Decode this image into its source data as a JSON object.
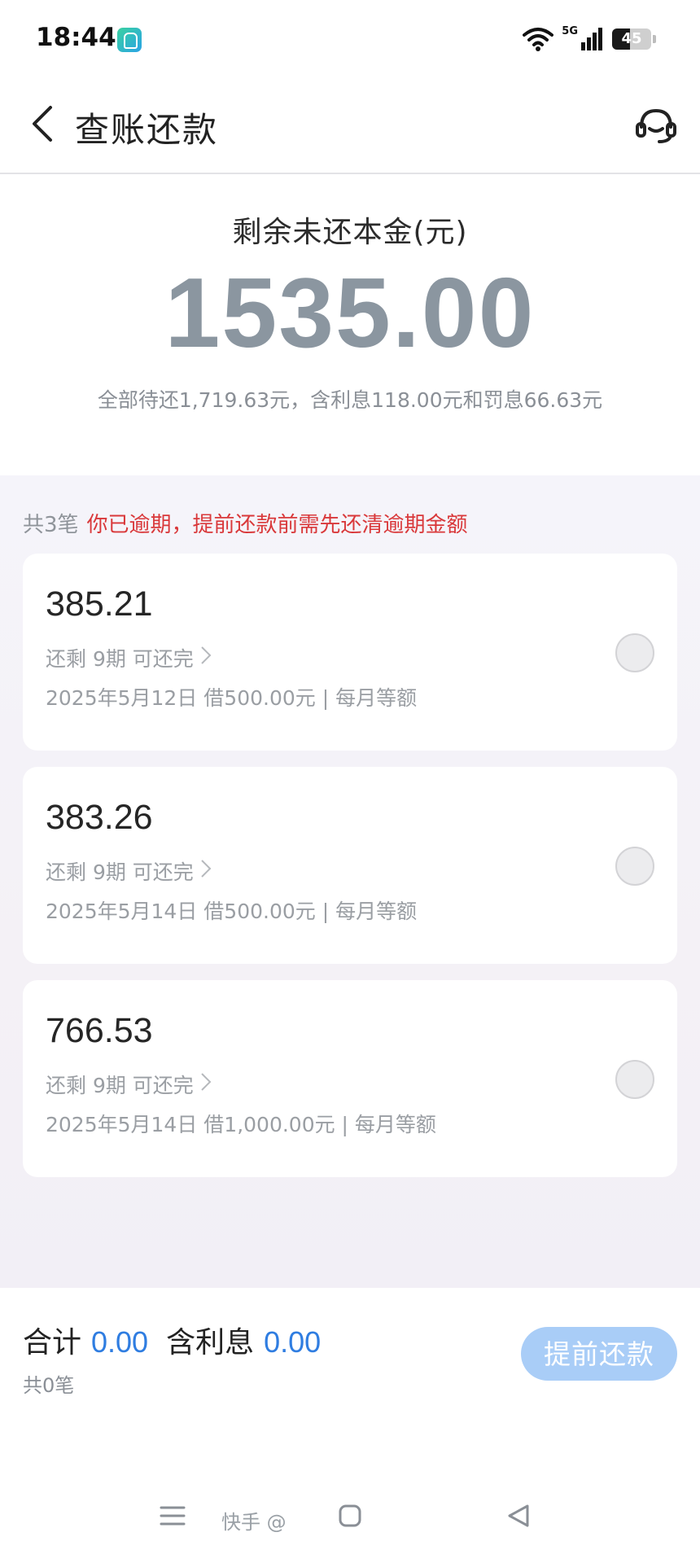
{
  "status_bar": {
    "time": "18:44",
    "network": "5G",
    "battery": "45",
    "battery_level": 0.45
  },
  "header": {
    "title": "查账还款",
    "back_icon": "chevron-left-icon",
    "service_icon": "headset-icon"
  },
  "summary": {
    "label": "剩余未还本金(元)",
    "amount": "1535.00",
    "detail": "全部待还1,719.63元，含利息118.00元和罚息66.63元"
  },
  "list": {
    "count_text": "共3笔",
    "warning_text": "你已逾期，提前还款前需先还清逾期金额",
    "loans": [
      {
        "amount": "385.21",
        "remaining": "还剩 9期 可还完",
        "info": "2025年5月12日 借500.00元 | 每月等额",
        "selected": false
      },
      {
        "amount": "383.26",
        "remaining": "还剩 9期 可还完",
        "info": "2025年5月14日 借500.00元 | 每月等额",
        "selected": false
      },
      {
        "amount": "766.53",
        "remaining": "还剩 9期 可还完",
        "info": "2025年5月14日 借1,000.00元 | 每月等额",
        "selected": false
      }
    ]
  },
  "footer": {
    "total_label": "合计",
    "total_value": "0.00",
    "interest_label": "含利息",
    "interest_value": "0.00",
    "count_text": "共0笔",
    "button_label": "提前还款"
  },
  "nav": {
    "watermark": "快手 @"
  },
  "colors": {
    "accent_blue": "#2f7de1",
    "button_disabled": "#a9cdf7",
    "warning_red": "#d9383a",
    "amount_gray": "#8b96a0"
  }
}
